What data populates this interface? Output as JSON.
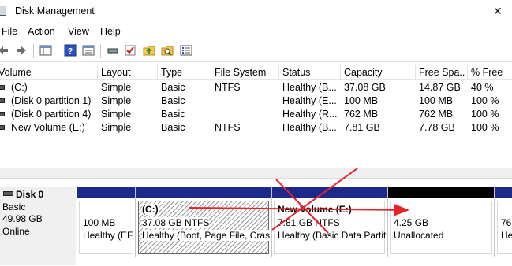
{
  "window": {
    "title": "Disk Management",
    "icon": "disk-management-icon",
    "close_glyph": "✕"
  },
  "menu": [
    "File",
    "Action",
    "View",
    "Help"
  ],
  "toolbar": {
    "icons": [
      "back-icon",
      "forward-icon",
      "console-tree-icon",
      "help-icon",
      "properties-icon",
      "connect-icon",
      "check-icon",
      "folder-up-icon",
      "search-icon",
      "settings-list-icon"
    ]
  },
  "volume_list": {
    "headers": [
      "Volume",
      "Layout",
      "Type",
      "File System",
      "Status",
      "Capacity",
      "Free Spa...",
      "% Free"
    ],
    "rows": [
      [
        "(C:)",
        "Simple",
        "Basic",
        "NTFS",
        "Healthy (B...",
        "37.08 GB",
        "14.87 GB",
        "40 %"
      ],
      [
        "(Disk 0 partition 1)",
        "Simple",
        "Basic",
        "",
        "Healthy (E...",
        "100 MB",
        "100 MB",
        "100 %"
      ],
      [
        "(Disk 0 partition 4)",
        "Simple",
        "Basic",
        "",
        "Healthy (R...",
        "762 MB",
        "762 MB",
        "100 %"
      ],
      [
        "New Volume (E:)",
        "Simple",
        "Basic",
        "NTFS",
        "Healthy (B...",
        "7.81 GB",
        "7.78 GB",
        "100 %"
      ]
    ]
  },
  "disk0": {
    "name": "Disk 0",
    "type": "Basic",
    "size": "49.98 GB",
    "status": "Online",
    "partitions": [
      {
        "title": "",
        "size": "100 MB",
        "status": "Healthy (EF"
      },
      {
        "title": "(C:)",
        "size": "37.08 GB NTFS",
        "status": "Healthy (Boot, Page File, Cras"
      },
      {
        "title": "New Volume  (E:)",
        "size": "7.81 GB NTFS",
        "status": "Healthy (Basic Data Partit"
      },
      {
        "title": "",
        "size": "4.25 GB",
        "status": "Unallocated"
      },
      {
        "title": "",
        "size": "76",
        "status": "He"
      }
    ]
  },
  "annotation": {
    "color": "#e8222a"
  }
}
